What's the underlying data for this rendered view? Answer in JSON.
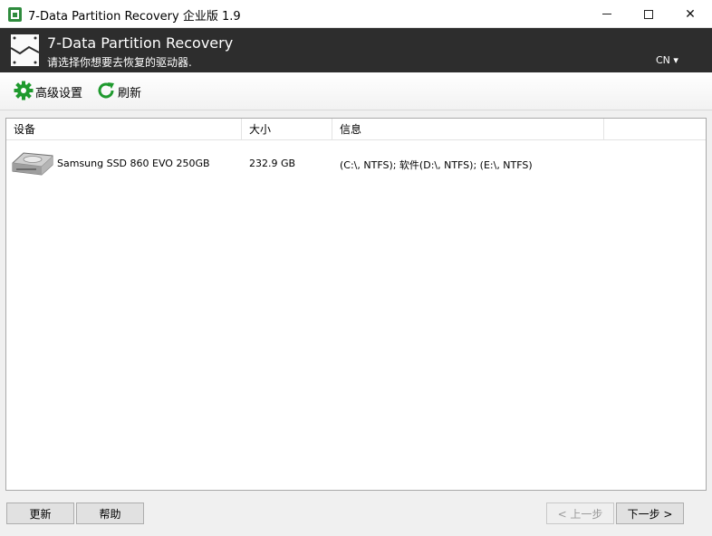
{
  "window": {
    "title": "7-Data Partition Recovery 企业版 1.9",
    "controls": {
      "minimize": "minimize-icon",
      "maximize": "maximize-icon",
      "close": "✕"
    }
  },
  "header": {
    "title": "7-Data Partition Recovery",
    "subtitle": "请选择你想要去恢复的驱动器.",
    "language": "CN ▾"
  },
  "toolbar": {
    "advanced_label": "高级设置",
    "refresh_label": "刷新"
  },
  "list": {
    "columns": [
      "设备",
      "大小",
      "信息",
      ""
    ],
    "rows": [
      {
        "device": "Samsung SSD 860 EVO 250GB",
        "size": "232.9 GB",
        "info": "(C:\\, NTFS); 软件(D:\\, NTFS); (E:\\, NTFS)",
        "icon": "hard-drive-icon"
      }
    ]
  },
  "footer": {
    "update_label": "更新",
    "help_label": "帮助",
    "prev_label": "< 上一步",
    "next_label": "下一步 >"
  },
  "colors": {
    "header_bg": "#2d2d2d",
    "accent_green": "#1f9a2e"
  }
}
